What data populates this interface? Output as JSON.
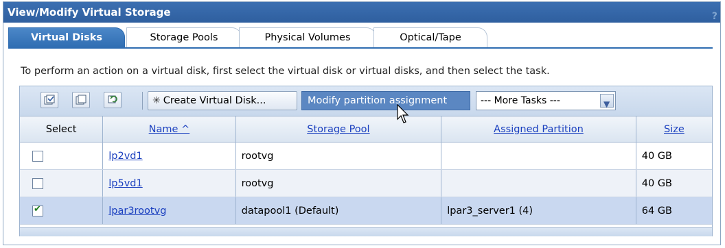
{
  "window": {
    "title": "View/Modify Virtual Storage",
    "help": "?"
  },
  "tabs": [
    {
      "label": "Virtual Disks",
      "active": true
    },
    {
      "label": "Storage Pools",
      "active": false
    },
    {
      "label": "Physical Volumes",
      "active": false
    },
    {
      "label": "Optical/Tape",
      "active": false
    }
  ],
  "instruction": "To perform an action on a virtual disk, first select the virtual disk or virtual disks, and then select the task.",
  "toolbar": {
    "icons": [
      "select-all-icon",
      "deselect-all-icon",
      "refresh-icon"
    ],
    "create_label": "Create Virtual Disk...",
    "modify_label": "Modify partition assignment",
    "more_tasks": "--- More Tasks ---"
  },
  "table": {
    "headers": {
      "select": "Select",
      "name": "Name ^",
      "pool": "Storage Pool",
      "partition": "Assigned Partition",
      "size": "Size"
    },
    "rows": [
      {
        "checked": false,
        "name": "lp2vd1",
        "pool": "rootvg",
        "partition": "",
        "size": "40 GB"
      },
      {
        "checked": false,
        "name": "lp5vd1",
        "pool": "rootvg",
        "partition": "",
        "size": "40 GB"
      },
      {
        "checked": true,
        "name": "lpar3rootvg",
        "pool": "datapool1 (Default)",
        "partition": "lpar3_server1 (4)",
        "size": "64 GB"
      }
    ]
  },
  "colors": {
    "title_bar": "#2f5f9f",
    "accent": "#5b87c2",
    "selected_row": "#c9d8f0",
    "link": "#1a3fbf"
  }
}
